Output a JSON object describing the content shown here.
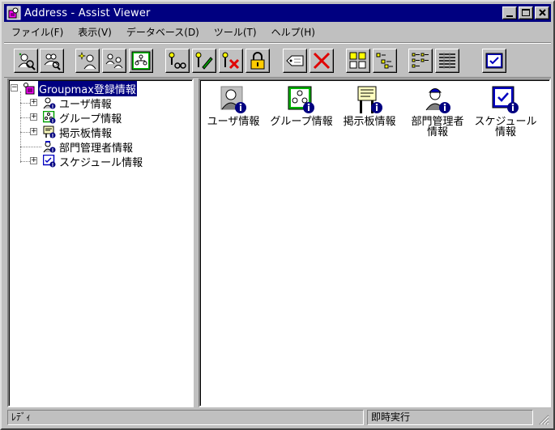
{
  "window": {
    "title": "Address - Assist Viewer",
    "controls": [
      "minimize-icon",
      "maximize-icon",
      "close-icon"
    ]
  },
  "menu": [
    "ファイル(F)",
    "表示(V)",
    "データベース(D)",
    "ツール(T)",
    "ヘルプ(H)"
  ],
  "toolbar": {
    "buttons": [
      "user-search-icon",
      "group-search-icon",
      "new-user-icon",
      "user-group-icon",
      "group-tree-icon",
      "find-key-icon",
      "edit-key-icon",
      "delete-key-icon",
      "lock-icon",
      "tag-icon",
      "delete-icon",
      "large-icons-view-icon",
      "small-icons-view-icon",
      "list-view-icon",
      "details-view-icon",
      "schedule-icon"
    ]
  },
  "tree": {
    "root": "Groupmax登録情報",
    "children": [
      {
        "label": "ユーザ情報",
        "icon": "user-info-icon",
        "expandable": true
      },
      {
        "label": "グループ情報",
        "icon": "group-info-icon",
        "expandable": true
      },
      {
        "label": "掲示板情報",
        "icon": "bulletin-board-icon",
        "expandable": true
      },
      {
        "label": "部門管理者情報",
        "icon": "department-admin-icon",
        "expandable": false
      },
      {
        "label": "スケジュール情報",
        "icon": "schedule-info-icon",
        "expandable": true
      }
    ]
  },
  "content_items": [
    {
      "label": "ユーザ情報",
      "icon": "user-info-icon"
    },
    {
      "label": "グループ情報",
      "icon": "group-info-icon"
    },
    {
      "label": "掲示板情報",
      "icon": "bulletin-board-icon"
    },
    {
      "label": "部門管理者\n情報",
      "icon": "department-admin-icon"
    },
    {
      "label": "スケジュール\n情報",
      "icon": "schedule-info-icon"
    }
  ],
  "status": {
    "left": "ﾚﾃﾞｨ",
    "right": "即時実行"
  },
  "colors": {
    "title_bar": "#000080",
    "face": "#c0c0c0",
    "selection": "#000080"
  }
}
